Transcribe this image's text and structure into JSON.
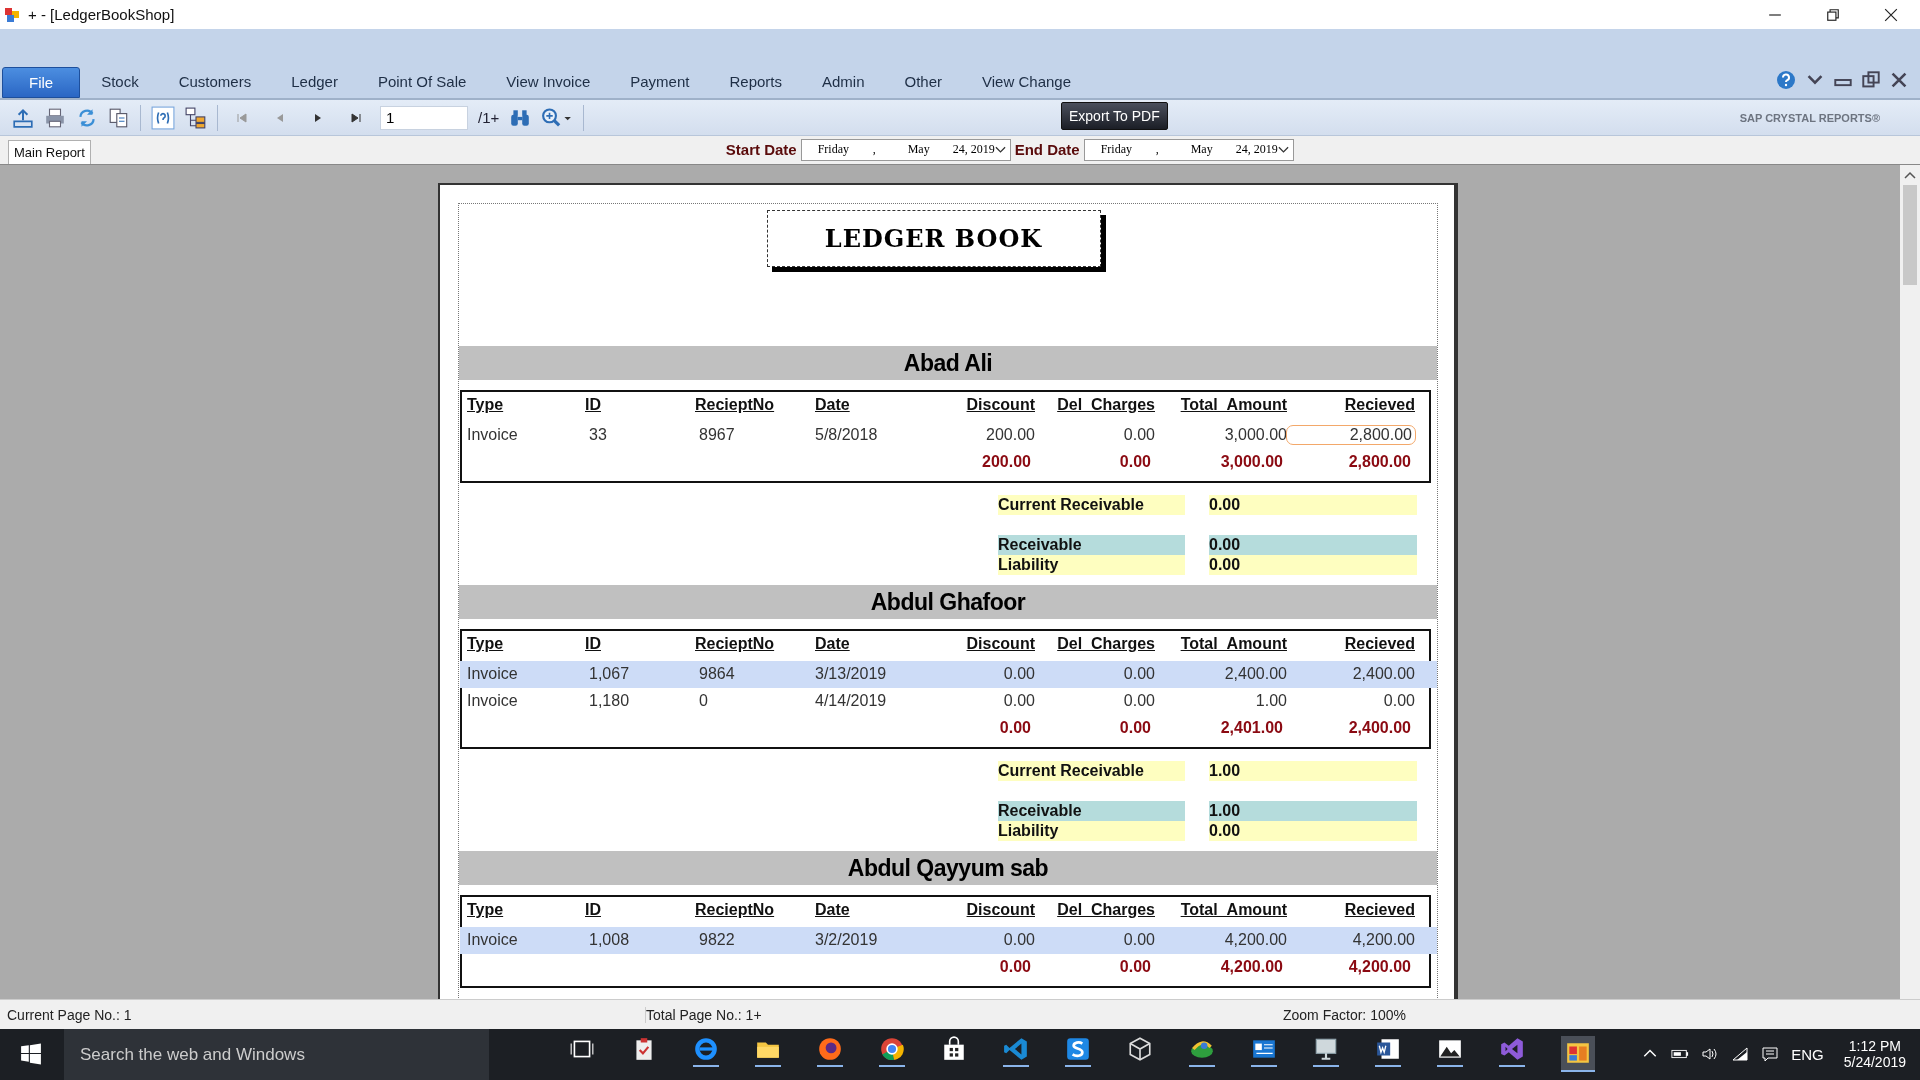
{
  "window": {
    "title": "+ - [LedgerBookShop]"
  },
  "menu": [
    {
      "label": "File",
      "selected": true
    },
    {
      "label": "Stock",
      "selected": false
    },
    {
      "label": "Customers",
      "selected": false
    },
    {
      "label": "Ledger",
      "selected": false
    },
    {
      "label": "Point Of Sale",
      "selected": false
    },
    {
      "label": "View Invoice",
      "selected": false
    },
    {
      "label": "Payment",
      "selected": false
    },
    {
      "label": "Reports",
      "selected": false
    },
    {
      "label": "Admin",
      "selected": false
    },
    {
      "label": "Other",
      "selected": false
    },
    {
      "label": "View Change",
      "selected": false
    }
  ],
  "toolbar": {
    "page_field": "1",
    "page_count": "/1+",
    "tooltip": "Export To PDF",
    "brand": "SAP CRYSTAL REPORTS®"
  },
  "report_tabs": [
    {
      "label": "Main Report"
    }
  ],
  "date_filters": [
    {
      "label": "Start Date",
      "parts": [
        "Friday",
        ",",
        "May",
        "24, 2019"
      ]
    },
    {
      "label": "End Date",
      "parts": [
        "Friday",
        ",",
        "May",
        "24, 2019"
      ]
    }
  ],
  "report": {
    "title": "LEDGER BOOK",
    "groups": [
      {
        "name": "Abad Ali",
        "columns": [
          "Type",
          "ID",
          "RecieptNo",
          "Date",
          "Discount",
          "Del_Charges",
          "Total_Amount",
          "Recieved"
        ],
        "rows": [
          {
            "selected": false,
            "focused": true,
            "cells": [
              "Invoice",
              "33",
              "8967",
              "5/8/2018",
              "200.00",
              "0.00",
              "3,000.00",
              "2,800.00"
            ]
          }
        ],
        "totals": [
          "200.00",
          "0.00",
          "3,000.00",
          "2,800.00"
        ],
        "summary": [
          {
            "kind": "current",
            "label": "Current Receivable",
            "value": "0.00"
          },
          {
            "kind": "receivable",
            "label": "Receivable",
            "value": "0.00"
          },
          {
            "kind": "liability",
            "label": "Liability",
            "value": "0.00"
          }
        ]
      },
      {
        "name": "Abdul Ghafoor",
        "columns": [
          "Type",
          "ID",
          "RecieptNo",
          "Date",
          "Discount",
          "Del_Charges",
          "Total_Amount",
          "Recieved"
        ],
        "rows": [
          {
            "selected": true,
            "focused": false,
            "cells": [
              "Invoice",
              "1,067",
              "9864",
              "3/13/2019",
              "0.00",
              "0.00",
              "2,400.00",
              "2,400.00"
            ]
          },
          {
            "selected": false,
            "focused": false,
            "cells": [
              "Invoice",
              "1,180",
              "0",
              "4/14/2019",
              "0.00",
              "0.00",
              "1.00",
              "0.00"
            ]
          }
        ],
        "totals": [
          "0.00",
          "0.00",
          "2,401.00",
          "2,400.00"
        ],
        "summary": [
          {
            "kind": "current",
            "label": "Current Receivable",
            "value": "1.00"
          },
          {
            "kind": "receivable",
            "label": "Receivable",
            "value": "1.00"
          },
          {
            "kind": "liability",
            "label": "Liability",
            "value": "0.00"
          }
        ]
      },
      {
        "name": "Abdul Qayyum sab",
        "columns": [
          "Type",
          "ID",
          "RecieptNo",
          "Date",
          "Discount",
          "Del_Charges",
          "Total_Amount",
          "Recieved"
        ],
        "rows": [
          {
            "selected": true,
            "focused": false,
            "cells": [
              "Invoice",
              "1,008",
              "9822",
              "3/2/2019",
              "0.00",
              "0.00",
              "4,200.00",
              "4,200.00"
            ]
          }
        ],
        "totals": [
          "0.00",
          "0.00",
          "4,200.00",
          "4,200.00"
        ]
      }
    ]
  },
  "status_bar": [
    "Current Page No.: 1",
    "Total Page No.: 1+",
    "Zoom Factor: 100%"
  ],
  "taskbar": {
    "search_placeholder": "Search the web and Windows",
    "language": "ENG",
    "time": "1:12 PM",
    "date": "5/24/2019"
  }
}
